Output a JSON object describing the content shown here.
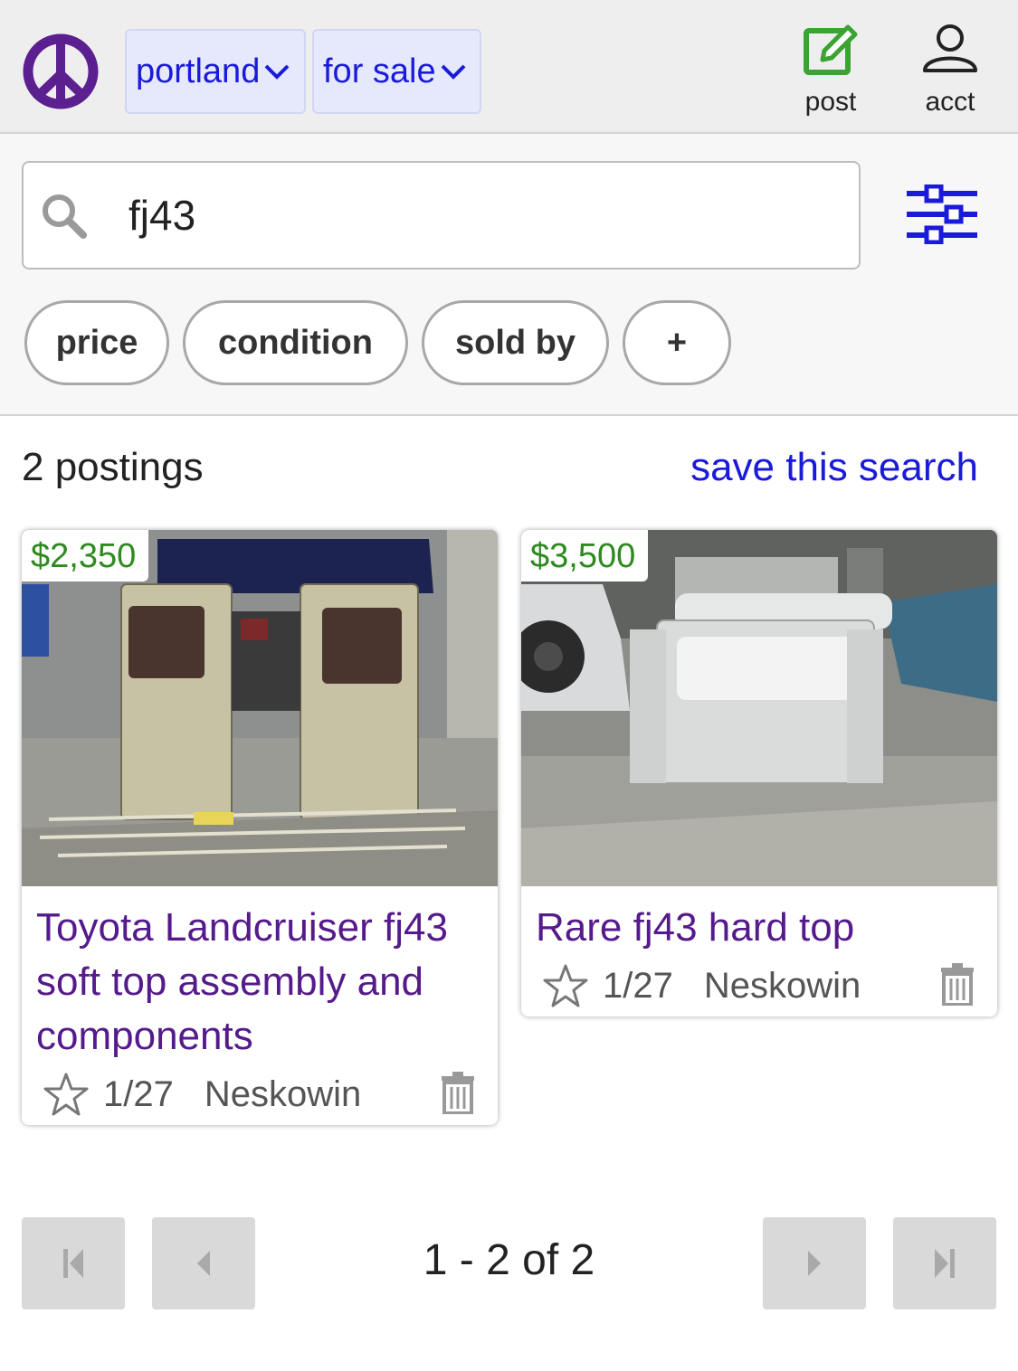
{
  "header": {
    "city": "portland",
    "category": "for sale",
    "post_label": "post",
    "acct_label": "acct"
  },
  "search": {
    "query": "fj43"
  },
  "filters": {
    "chips": [
      "price",
      "condition",
      "sold by",
      "+"
    ]
  },
  "results": {
    "count_label": "2 postings",
    "save_label": "save this search"
  },
  "listings": [
    {
      "price": "$2,350",
      "title": "Toyota Landcruiser fj43 soft top assembly and components",
      "date": "1/27",
      "location": "Neskowin"
    },
    {
      "price": "$3,500",
      "title": "Rare fj43 hard top",
      "date": "1/27",
      "location": "Neskowin"
    }
  ],
  "pagination": {
    "info": "1 - 2 of 2"
  },
  "colors": {
    "link_blue": "#1a1adb",
    "visited_purple": "#551a8b",
    "price_green": "#2f8a1f",
    "logo_purple": "#5b1f8f",
    "post_green": "#3aa331"
  }
}
